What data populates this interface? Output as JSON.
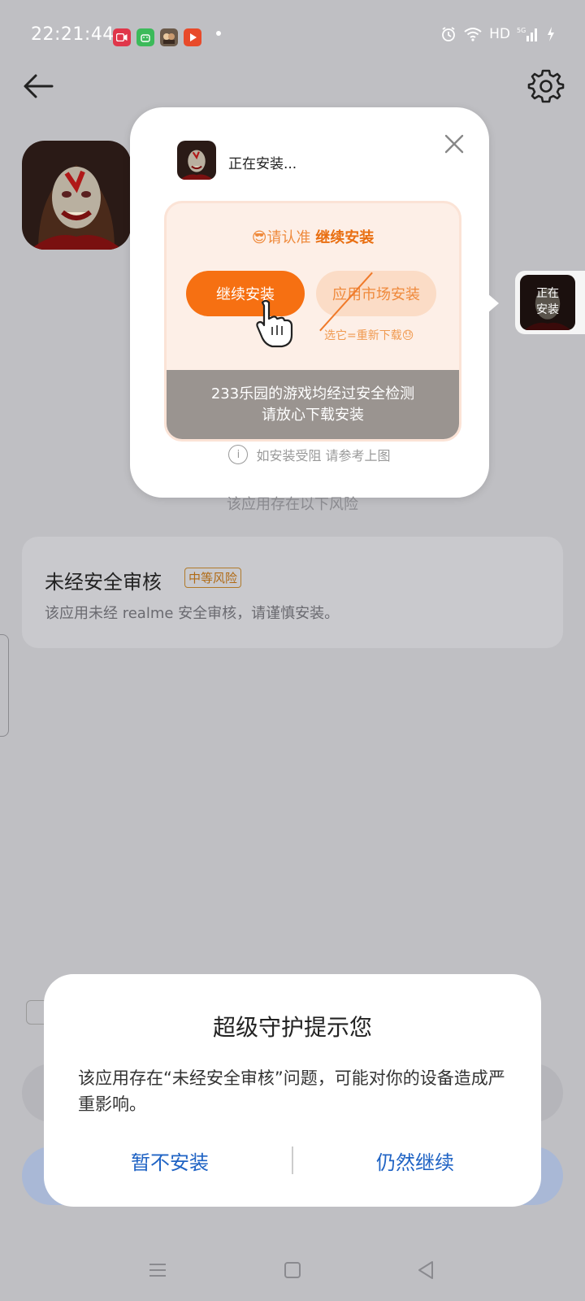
{
  "status_bar": {
    "time": "22:21:44",
    "network": "HD",
    "icons": [
      "video-recorder-icon",
      "app-market-icon",
      "game-thumb-icon",
      "play-icon",
      "alarm-icon",
      "wifi-icon",
      "signal-5g-icon",
      "charging-icon"
    ]
  },
  "header": {
    "back_icon": "arrow-left-icon",
    "settings_icon": "gear-icon"
  },
  "popup": {
    "installing_text": "正在安装...",
    "tip_prefix": "😎请认准",
    "tip_highlight": "继续安装",
    "continue_label": "继续安装",
    "market_label": "应用市场安装",
    "redownload_note": "选它=重新下载😓",
    "footer_line1": "233乐园的游戏均经过安全检测",
    "footer_line2": "请放心下载安装",
    "info_text": "如安装受阻 请参考上图"
  },
  "floating_bubble": {
    "line1": "正在",
    "line2": "安装"
  },
  "risk": {
    "heading": "该应用存在以下风险",
    "title": "未经安全审核",
    "badge": "中等风险",
    "description": "该应用未经 realme 安全审核，请谨慎安装。"
  },
  "dialog": {
    "title": "超级守护提示您",
    "message": "该应用存在“未经安全审核”问题，可能对你的设备造成严重影响。",
    "cancel_label": "暂不安装",
    "continue_label": "仍然继续"
  },
  "colors": {
    "accent_orange": "#f67012",
    "dialog_button_blue": "#1f63c4",
    "background_dim": "#bfbfc3"
  }
}
